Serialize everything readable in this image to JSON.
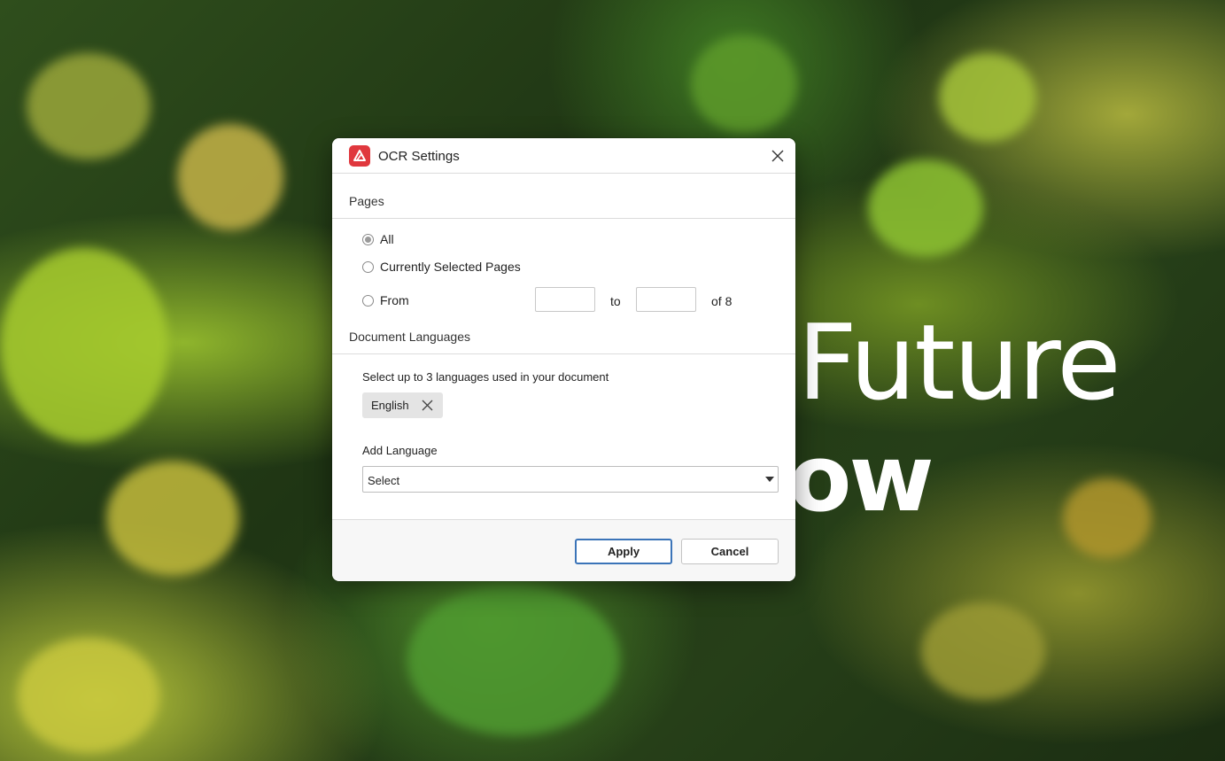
{
  "background": {
    "hero_line1": "Future",
    "hero_line2": "ow"
  },
  "dialog": {
    "title": "OCR Settings",
    "app_icon": "app-logo-icon",
    "close_icon": "close-icon",
    "pages": {
      "header": "Pages",
      "options": [
        {
          "label": "All",
          "checked": true
        },
        {
          "label": "Currently Selected Pages",
          "checked": false
        },
        {
          "label": "From",
          "checked": false
        }
      ],
      "from_value": "",
      "to_label": "to",
      "to_value": "",
      "of_label": "of 8"
    },
    "languages": {
      "header": "Document Languages",
      "hint": "Select up to 3 languages used in your document",
      "selected": [
        "English"
      ],
      "add_label": "Add Language",
      "select_value": "Select"
    },
    "buttons": {
      "apply": "Apply",
      "cancel": "Cancel"
    }
  },
  "colors": {
    "brand": "#e0383e",
    "primary_border": "#3b74b8"
  }
}
